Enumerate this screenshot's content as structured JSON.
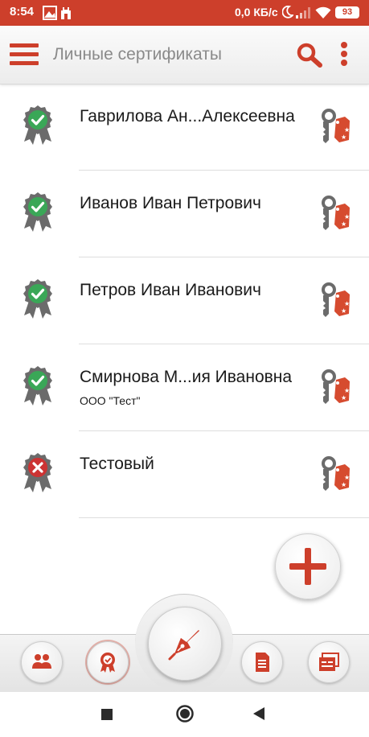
{
  "status_bar": {
    "time": "8:54",
    "network_speed": "0,0 КБ/с",
    "battery": "93"
  },
  "app_bar": {
    "title": "Личные сертификаты",
    "icons": [
      "menu-icon",
      "search-icon",
      "more-vert-icon"
    ]
  },
  "certificates": [
    {
      "name": "Гаврилова Ан...Алексеевна",
      "org": "",
      "status": "valid"
    },
    {
      "name": "Иванов Иван Петрович",
      "org": "",
      "status": "valid"
    },
    {
      "name": "Петров Иван Иванович",
      "org": "",
      "status": "valid"
    },
    {
      "name": "Смирнова М...ия Ивановна",
      "org": "ООО \"Тест\"",
      "status": "valid"
    },
    {
      "name": "Тестовый",
      "org": "",
      "status": "invalid"
    }
  ],
  "bottom_nav": [
    "contacts-icon",
    "certificates-icon",
    "sign-pen-icon",
    "documents-icon",
    "settings-window-icon"
  ],
  "colors": {
    "accent": "#cd3f2b",
    "valid": "#3aa757",
    "invalid": "#cc3333",
    "ribbon": "#6b6b6b"
  }
}
